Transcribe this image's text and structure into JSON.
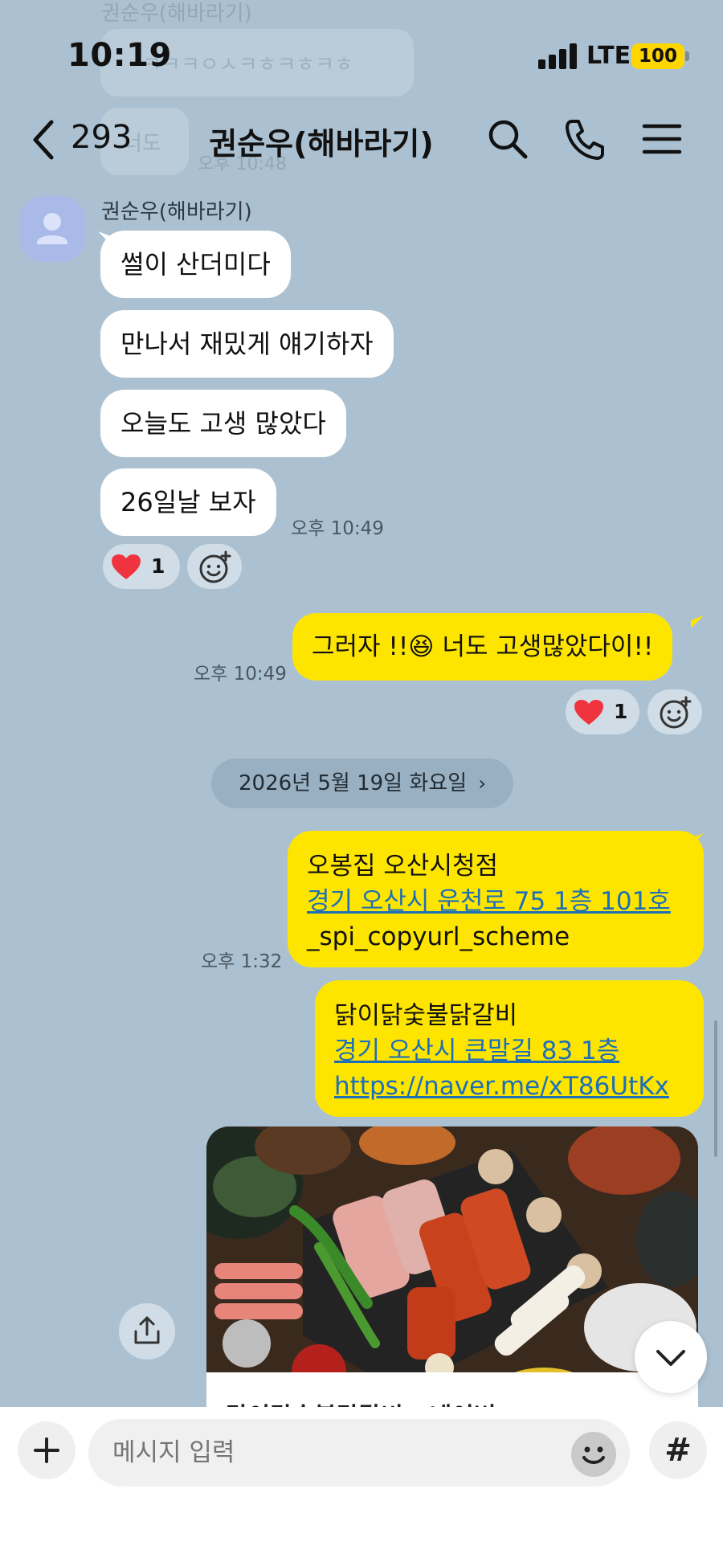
{
  "status_bar": {
    "time": "10:19",
    "network": "LTE",
    "battery": "100"
  },
  "header": {
    "back_count": "293",
    "title": "권순우(해바라기)"
  },
  "ghost_above": {
    "name": "권순우(해바라기)",
    "bubble1": "ㅋㅋㅋㅇㅅㅋㅎㅋㅎㅋㅎ",
    "bubble2": "너도",
    "time": "오후 10:48"
  },
  "incoming": {
    "sender": "권순우(해바라기)",
    "messages": [
      "썰이 산더미다",
      "만나서 재밌게 얘기하자",
      "오늘도 고생 많았다",
      "26일날 보자"
    ],
    "time": "오후 10:49",
    "reaction_count": "1"
  },
  "outgoing_reply": {
    "text": "그러자 !!😆 너도 고생많았다이!!",
    "time": "오후 10:49",
    "reaction_count": "1"
  },
  "date_divider": "2026년 5월 19일 화요일",
  "place_messages": [
    {
      "name": "오봉집 오산시청점",
      "address": "경기 오산시 운천로 75 1층 101호",
      "extra": "_spi_copyurl_scheme",
      "time": "오후 1:32"
    },
    {
      "name": "닭이닭숯불닭갈비",
      "address": "경기 오산시 큰말길 83 1층",
      "url": "https://naver.me/xT86UtKx"
    }
  ],
  "link_preview": {
    "caption": "닭이닭숯불닭갈비 : 네이버"
  },
  "input": {
    "placeholder": "메시지 입력",
    "hash_label": "#"
  }
}
